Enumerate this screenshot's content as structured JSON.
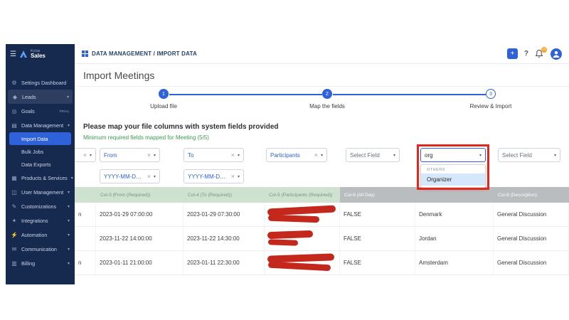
{
  "colors": {
    "accent": "#2f62d8",
    "sidebar_bg": "#16294e",
    "green": "#3c9d4e",
    "annotation_red": "#e2271b"
  },
  "icons": {
    "hamburger": "☰",
    "gear": "⚙",
    "leads": "◆",
    "goals": "◎",
    "data_management": "▤",
    "products": "▦",
    "users": "◫",
    "customizations": "✎",
    "integrations": "✦",
    "automation": "⚡",
    "communication": "✉",
    "billing": "▥",
    "caret_down": "▾",
    "close": "×",
    "help": "?",
    "plus": "+"
  },
  "sidebar": {
    "brand_top": "Kylas",
    "brand_bottom": "Sales",
    "items": [
      {
        "label": "Settings Dashboard"
      },
      {
        "label": "Leads"
      },
      {
        "label": "Goals",
        "badge": "TRIAL"
      },
      {
        "label": "Data Management"
      },
      {
        "label": "Products & Services"
      },
      {
        "label": "User Management"
      },
      {
        "label": "Customizations"
      },
      {
        "label": "Integrations"
      },
      {
        "label": "Automation"
      },
      {
        "label": "Communication"
      },
      {
        "label": "Billing"
      }
    ],
    "sub": [
      "Import Data",
      "Bulk Jobs",
      "Data Exports"
    ]
  },
  "topbar": {
    "breadcrumb": "DATA MANAGEMENT / IMPORT DATA",
    "bell_badge": "15"
  },
  "page": {
    "title": "Import Meetings"
  },
  "stepper": {
    "steps": [
      {
        "num": "1",
        "label": "Upload file"
      },
      {
        "num": "2",
        "label": "Map the fields"
      },
      {
        "num": "3",
        "label": "Review & Import"
      }
    ]
  },
  "mapping": {
    "heading": "Please map your file columns with system fields provided",
    "subheading": "Minimum required fields mapped for Meeting (5/5)",
    "from": "From",
    "to": "To",
    "participants": "Participants",
    "select_field": "Select Field",
    "org_value": "org",
    "date_format": "YYYY-MM-DD H...",
    "menu_group": "OTHERS",
    "menu_option": "Organizer"
  },
  "table": {
    "headers": {
      "c3": "Col-3 (From (Required))",
      "c4": "Col-4 (To (Required))",
      "c5": "Col-5 (Participants (Required))",
      "c6": "Col-6 (All Day)",
      "c8": "Col-8 (Description)"
    },
    "rows": [
      {
        "c0": "n",
        "from": "2023-01-29 07:00:00",
        "to": "2023-01-29 07:30:00",
        "all_day": "FALSE",
        "location": "Denmark",
        "description": "General Discussion"
      },
      {
        "c0": "",
        "from": "2023-11-22 14:00:00",
        "to": "2023-11-22 14:30:00",
        "all_day": "FALSE",
        "location": "Jordan",
        "description": "General Discussion"
      },
      {
        "c0": "n",
        "from": "2023-01-11 21:00:00",
        "to": "2023-01-11 22:30:00",
        "all_day": "FALSE",
        "location": "Amsterdam",
        "description": "General Discussion"
      }
    ]
  }
}
